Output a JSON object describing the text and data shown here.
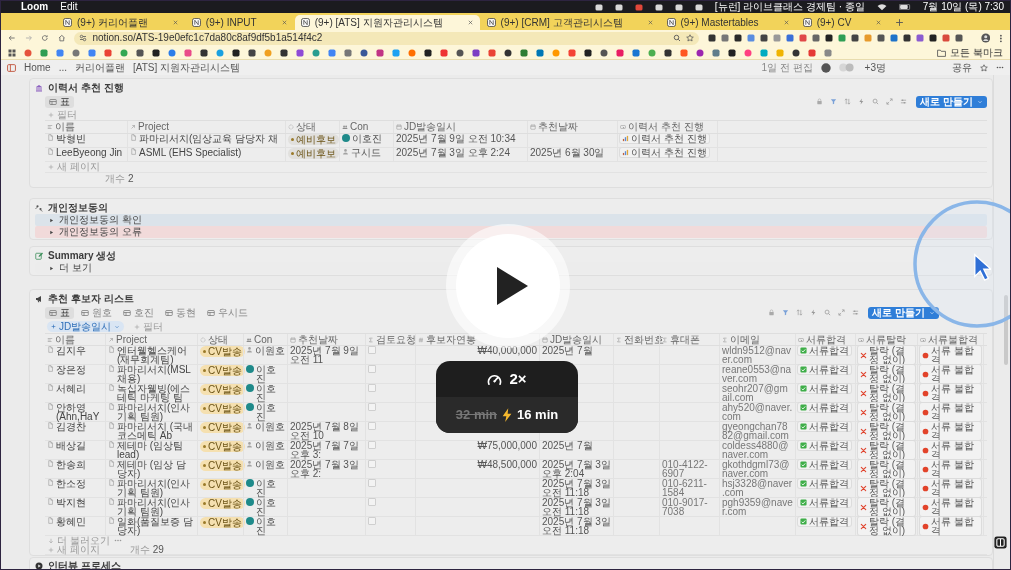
{
  "menu_bar": {
    "app": "Loom",
    "items": [
      "Edit"
    ],
    "status_text": "[뉴런] 라이브클래스 경제팀 · 종일",
    "clock": "7월 10일 (목) 7:30"
  },
  "browser": {
    "tabs": [
      {
        "title": "(9+) 커리어플랜",
        "selected": false
      },
      {
        "title": "(9+) INPUT",
        "selected": false
      },
      {
        "title": "(9+) [ATS] 지원자관리시스템",
        "selected": true
      },
      {
        "title": "(9+) [CRM] 고객관리시스템",
        "selected": false
      },
      {
        "title": "(9+) Mastertables",
        "selected": false
      },
      {
        "title": "(9+) CV",
        "selected": false
      }
    ],
    "url": "notion.so/ATS-19e0efc1c7da80c8af9df5b1a514f4c2",
    "bookmarks_folder": "모든 북마크"
  },
  "notion_topbar": {
    "breadcrumbs": [
      "Home",
      "...",
      "커리어플랜",
      "[ATS] 지원자관리시스템"
    ],
    "edited": "1일 전 편집",
    "viewers": "+3명",
    "share": "공유"
  },
  "resume_section": {
    "title": "이력서 추천 진행",
    "views": [
      {
        "label": "표",
        "selected": true
      }
    ],
    "add_filter": "필터",
    "new_button": "새로 만들기",
    "columns": [
      {
        "label": "이름",
        "kind": "title"
      },
      {
        "label": "Project",
        "kind": "relation"
      },
      {
        "label": "상태",
        "kind": "status"
      },
      {
        "label": "Con",
        "kind": "person"
      },
      {
        "label": "JD발송일시",
        "kind": "date"
      },
      {
        "label": "추천날짜",
        "kind": "date"
      },
      {
        "label": "이력서 추천 진행",
        "kind": "button"
      }
    ],
    "rows": [
      {
        "cells": [
          "박형빈",
          "파마리서치(임상교육 담당자 채",
          {
            "label": "예비후보",
            "color": "#e1e0dd"
          },
          {
            "name": "이호진",
            "avatar": true
          },
          "2025년 7월 9일 오전 10:34",
          null,
          {
            "label": "이력서 추천 진행",
            "kind": "chart"
          }
        ]
      },
      {
        "cells": [
          "LeeByeong Jin",
          "ASML (EHS Specialist)",
          {
            "label": "예비후보",
            "color": "#e1e0dd"
          },
          {
            "name": "구시드",
            "avatar": false
          },
          "2025년 7월 3일 오후 2:24",
          "2025년 6월 30일",
          {
            "label": "이력서 추천 진행",
            "kind": "chart"
          }
        ]
      }
    ],
    "new_page": "새 페이지",
    "count_label": "개수",
    "count": "2"
  },
  "consent_section": {
    "title": "개인정보동의",
    "toggles": [
      {
        "label": "개인정보동의 확인",
        "color": "#dbe3ea"
      },
      {
        "label": "개인정보동의 오류",
        "color": "#f1dada"
      }
    ]
  },
  "summary_section": {
    "title": "Summary 생성",
    "toggles": [
      {
        "label": "더 보기",
        "color": "#ececec"
      }
    ]
  },
  "candidate_section": {
    "title": "추천 후보자 리스트",
    "views": [
      {
        "label": "표",
        "selected": true
      },
      {
        "label": "원호",
        "selected": false
      },
      {
        "label": "호진",
        "selected": false
      },
      {
        "label": "동현",
        "selected": false
      },
      {
        "label": "우시드",
        "selected": false
      }
    ],
    "filter_chip": "JD발송일시",
    "add_filter": "필터",
    "new_button": "새로 만들기",
    "columns": [
      {
        "label": "이름",
        "kind": "title"
      },
      {
        "label": "Project",
        "kind": "relation"
      },
      {
        "label": "상태",
        "kind": "status"
      },
      {
        "label": "Con",
        "kind": "person"
      },
      {
        "label": "추천날짜",
        "kind": "date"
      },
      {
        "label": "검토요청",
        "kind": "formula"
      },
      {
        "label": "후보자연봉",
        "kind": "number"
      },
      {
        "label": "JD발송일시",
        "kind": "date"
      },
      {
        "label": "전화번호",
        "kind": "formula"
      },
      {
        "label": "휴대폰",
        "kind": "formula"
      },
      {
        "label": "이메일",
        "kind": "formula"
      },
      {
        "label": "서류합격",
        "kind": "button"
      },
      {
        "label": "서류탈락",
        "kind": "button"
      },
      {
        "label": "서류불합격",
        "kind": "button"
      }
    ],
    "rows": [
      {
        "cells": [
          "김지우",
          "엔터웰헬스케어(재무회계팀)",
          {
            "label": "CV발송",
            "color": "#f5e0b0"
          },
          {
            "name": "이원호",
            "avatar": false
          },
          "2025년 7월 9일 오전 11",
          false,
          "₩40,000,000",
          "2025년 7월",
          null,
          null,
          "wldn9512@naver.com",
          {
            "label": "서류합격",
            "kind": "pass"
          },
          {
            "label": "탈락 (결정 없이)",
            "kind": "reject"
          },
          {
            "label": "서류 불합격",
            "kind": "fail"
          }
        ]
      },
      {
        "cells": [
          "장은정",
          "파마리서치(MSL 채용)",
          {
            "label": "CV발송",
            "color": "#f5e0b0"
          },
          {
            "name": "이호진",
            "avatar": true
          },
          null,
          false,
          null,
          null,
          null,
          null,
          "reane0553@naver.com",
          {
            "label": "서류합격",
            "kind": "pass"
          },
          {
            "label": "탈락 (결정 없이)",
            "kind": "reject"
          },
          {
            "label": "서류 불합격",
            "kind": "fail"
          }
        ]
      },
      {
        "cells": [
          "서혜리",
          "녹십자웰빙(에스테틱 마케팅 팀",
          {
            "label": "CV발송",
            "color": "#f5e0b0"
          },
          {
            "name": "이호진",
            "avatar": true
          },
          null,
          false,
          null,
          null,
          null,
          null,
          "seohr207@gmail.com",
          {
            "label": "서류합격",
            "kind": "pass"
          },
          {
            "label": "탈락 (결정 없이)",
            "kind": "reject"
          },
          {
            "label": "서류 불합격",
            "kind": "fail"
          }
        ]
      },
      {
        "cells": [
          "안하영(Ahn,HaY",
          "파마리서치(인사기획 팀원)",
          {
            "label": "CV발송",
            "color": "#f5e0b0"
          },
          {
            "name": "이호진",
            "avatar": true
          },
          null,
          false,
          null,
          null,
          null,
          null,
          "ahy520@naver.com",
          {
            "label": "서류합격",
            "kind": "pass"
          },
          {
            "label": "탈락 (결정 없이)",
            "kind": "reject"
          },
          {
            "label": "서류 불합격",
            "kind": "fail"
          }
        ]
      },
      {
        "cells": [
          "김경찬",
          "파마리서치 (국내 코스메틱 Ab",
          {
            "label": "CV발송",
            "color": "#f5e0b0"
          },
          {
            "name": "이원호",
            "avatar": false
          },
          "2025년 7월 8일 오전 10",
          false,
          null,
          null,
          null,
          null,
          "gyeongchan7882@gmail.com",
          {
            "label": "서류합격",
            "kind": "pass"
          },
          {
            "label": "탈락 (결정 없이)",
            "kind": "reject"
          },
          {
            "label": "서류 불합격",
            "kind": "fail"
          }
        ]
      },
      {
        "cells": [
          "배상길",
          "제테마 (임상팀 lead)",
          {
            "label": "CV발송",
            "color": "#f5e0b0"
          },
          {
            "name": "이원호",
            "avatar": false
          },
          "2025년 7월 7일 오후 3:",
          false,
          "₩75,000,000",
          "2025년 7월",
          null,
          null,
          "coldess4880@naver.com",
          {
            "label": "서류합격",
            "kind": "pass"
          },
          {
            "label": "탈락 (결정 없이)",
            "kind": "reject"
          },
          {
            "label": "서류 불합격",
            "kind": "fail"
          }
        ]
      },
      {
        "cells": [
          "한송희",
          "제테마 (임상 담당자)",
          {
            "label": "CV발송",
            "color": "#f5e0b0"
          },
          {
            "name": "이원호",
            "avatar": false
          },
          "2025년 7월 3일 오후 2:",
          false,
          "₩48,500,000",
          "2025년 7월 3일 오후 2:04",
          null,
          "010-4122-6907",
          "gkothdgml73@naver.com",
          {
            "label": "서류합격",
            "kind": "pass"
          },
          {
            "label": "탈락 (결정 없이)",
            "kind": "reject"
          },
          {
            "label": "서류 불합격",
            "kind": "fail"
          }
        ]
      },
      {
        "cells": [
          "한소정",
          "파마리서치(인사기획 팀원)",
          {
            "label": "CV발송",
            "color": "#f5e0b0"
          },
          {
            "name": "이호진",
            "avatar": true
          },
          null,
          false,
          null,
          "2025년 7월 3일 오전 11:18",
          null,
          "010-6211-1584",
          "hsj3328@naver.com",
          {
            "label": "서류합격",
            "kind": "pass"
          },
          {
            "label": "탈락 (결정 없이)",
            "kind": "reject"
          },
          {
            "label": "서류 불합격",
            "kind": "fail"
          }
        ]
      },
      {
        "cells": [
          "박지현",
          "파마리서치(인사기획 팀원)",
          {
            "label": "CV발송",
            "color": "#f5e0b0"
          },
          {
            "name": "이호진",
            "avatar": true
          },
          null,
          false,
          null,
          "2025년 7월 3일 오전 11:18",
          null,
          "010-9017-7038",
          "pgh9359@naver.com",
          {
            "label": "서류합격",
            "kind": "pass"
          },
          {
            "label": "탈락 (결정 없이)",
            "kind": "reject"
          },
          {
            "label": "서류 불합격",
            "kind": "fail"
          }
        ]
      },
      {
        "cells": [
          "황혜민",
          "일화(품질보증 담당자)",
          {
            "label": "CV발송",
            "color": "#f5e0b0"
          },
          {
            "name": "이호진",
            "avatar": true
          },
          null,
          false,
          null,
          "2025년 7월 3일 오전 11:18",
          null,
          null,
          null,
          {
            "label": "서류합격",
            "kind": "pass"
          },
          {
            "label": "탈락 (결정 없이)",
            "kind": "reject"
          },
          {
            "label": "서류 불합격",
            "kind": "fail"
          }
        ]
      }
    ],
    "load_more": "더 불러오기",
    "new_page": "새 페이지",
    "count_label": "개수",
    "count": "29"
  },
  "interview_section": {
    "title": "인터뷰 프로세스"
  },
  "player": {
    "speed": "2×",
    "original_duration": "32 min",
    "fast_duration": "16 min"
  }
}
